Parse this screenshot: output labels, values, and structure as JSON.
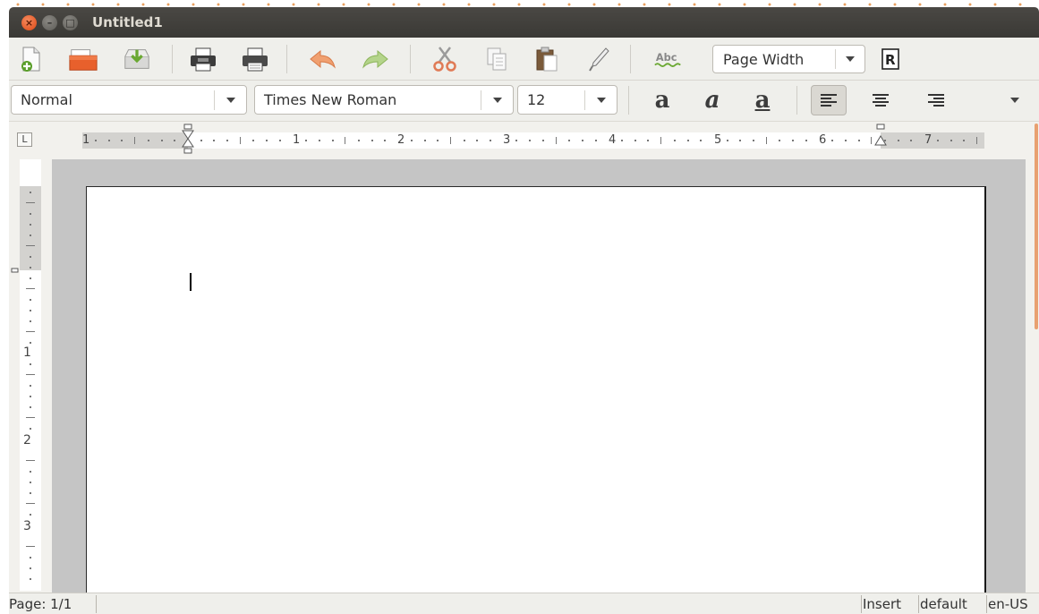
{
  "window": {
    "title": "Untitled1"
  },
  "toolbar": {
    "icons": [
      "new-document-icon",
      "open-icon",
      "save-icon",
      "print-preview-icon",
      "print-icon",
      "undo-icon",
      "redo-icon",
      "cut-icon",
      "copy-icon",
      "paste-icon",
      "clone-formatting-icon",
      "spellcheck-icon",
      "zoom-icon"
    ],
    "zoom_label": "Page Width",
    "spellcheck_glyph": "Abc"
  },
  "format": {
    "paragraph_style": "Normal",
    "font_name": "Times New Roman",
    "font_size": "12",
    "bold_glyph": "a",
    "italic_glyph": "a",
    "underline_glyph": "a"
  },
  "ruler": {
    "labels": [
      "1",
      "1",
      "2",
      "3",
      "4",
      "5",
      "6",
      "7"
    ],
    "vertical_labels": [
      "1",
      "2",
      "3"
    ]
  },
  "status": {
    "page": "Page: 1/1",
    "mode": "Insert",
    "page_style": "default",
    "language": "en-US"
  },
  "colors": {
    "accent": "#dd4814",
    "titlebar": "#3c3b37",
    "toolbar_bg": "#efefeb",
    "doc_bg": "#c5c5c5"
  }
}
